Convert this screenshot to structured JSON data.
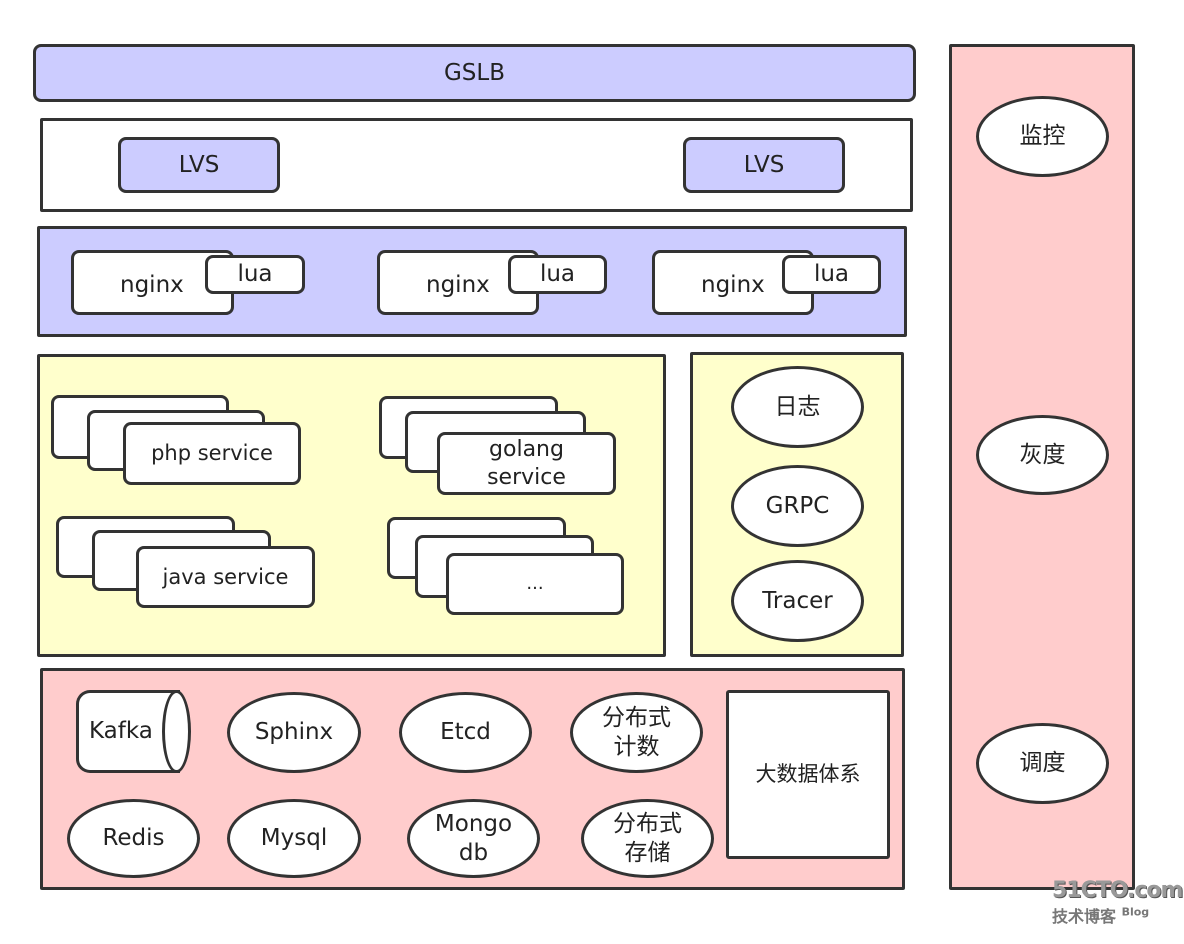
{
  "gslb": "GSLB",
  "lvs": [
    "LVS",
    "LVS"
  ],
  "nginx": [
    {
      "label": "nginx",
      "plugin": "lua"
    },
    {
      "label": "nginx",
      "plugin": "lua"
    },
    {
      "label": "nginx",
      "plugin": "lua"
    }
  ],
  "services": {
    "php": "php service",
    "golang": "golang\nservice",
    "java": "java service",
    "more": "..."
  },
  "infra": {
    "log": "日志",
    "grpc": "GRPC",
    "tracer": "Tracer"
  },
  "storage": {
    "kafka": "Kafka",
    "sphinx": "Sphinx",
    "etcd": "Etcd",
    "counter": "分布式\n计数",
    "redis": "Redis",
    "mysql": "Mysql",
    "mongo": "Mongo\ndb",
    "dstore": "分布式\n存储",
    "bigdata": "大数据体系"
  },
  "ops": {
    "monitor": "监控",
    "gray": "灰度",
    "schedule": "调度"
  },
  "colors": {
    "lavender": "#ccccff",
    "pink": "#ffcccc",
    "yellow": "#ffffcc"
  },
  "watermark": {
    "site": "51CTO.com",
    "sub": "技术博客",
    "blog": "Blog"
  }
}
